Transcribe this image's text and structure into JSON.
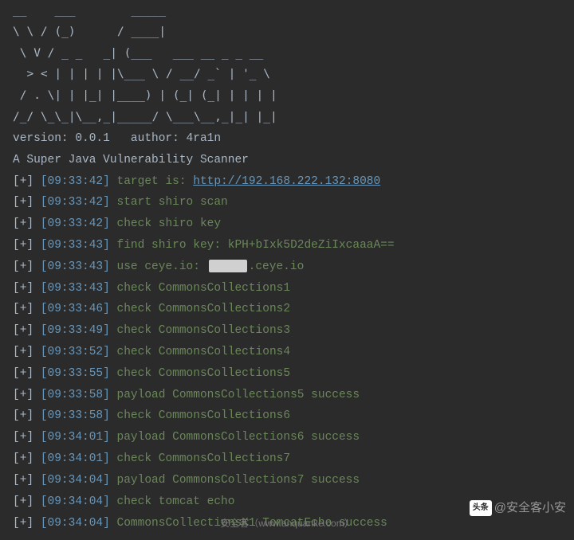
{
  "ascii_banner": [
    "__    ___        _____ ",
    "\\ \\ / (_)      / ____|",
    " \\ V / _ _   _| (___   ___ __ _ _ __ ",
    "  > < | | | | |\\___ \\ / __/ _` | '_ \\",
    " / . \\| | |_| |____) | (_| (_| | | | |",
    "/_/ \\_\\_|\\__,_|_____/ \\___\\__,_|_| |_|"
  ],
  "version_line": "version: 0.0.1   author: 4ra1n",
  "subtitle": "A Super Java Vulnerability Scanner",
  "prefix": "[+]",
  "target_url": "http://192.168.222.132:8080",
  "logs": [
    {
      "ts": "[09:33:42]",
      "type": "target",
      "pre": "target is: "
    },
    {
      "ts": "[09:33:42]",
      "type": "plain",
      "msg": "start shiro scan"
    },
    {
      "ts": "[09:33:42]",
      "type": "plain",
      "msg": "check shiro key"
    },
    {
      "ts": "[09:33:43]",
      "type": "plain",
      "msg": "find shiro key: kPH+bIxk5D2deZiIxcaaaA=="
    },
    {
      "ts": "[09:33:43]",
      "type": "ceye",
      "pre": "use ceye.io: ",
      "suf": ".ceye.io"
    },
    {
      "ts": "[09:33:43]",
      "type": "plain",
      "msg": "check CommonsCollections1"
    },
    {
      "ts": "[09:33:46]",
      "type": "plain",
      "msg": "check CommonsCollections2"
    },
    {
      "ts": "[09:33:49]",
      "type": "plain",
      "msg": "check CommonsCollections3"
    },
    {
      "ts": "[09:33:52]",
      "type": "plain",
      "msg": "check CommonsCollections4"
    },
    {
      "ts": "[09:33:55]",
      "type": "plain",
      "msg": "check CommonsCollections5"
    },
    {
      "ts": "[09:33:58]",
      "type": "plain",
      "msg": "payload CommonsCollections5 success"
    },
    {
      "ts": "[09:33:58]",
      "type": "plain",
      "msg": "check CommonsCollections6"
    },
    {
      "ts": "[09:34:01]",
      "type": "plain",
      "msg": "payload CommonsCollections6 success"
    },
    {
      "ts": "[09:34:01]",
      "type": "plain",
      "msg": "check CommonsCollections7"
    },
    {
      "ts": "[09:34:04]",
      "type": "plain",
      "msg": "payload CommonsCollections7 success"
    },
    {
      "ts": "[09:34:04]",
      "type": "plain",
      "msg": "check tomcat echo"
    },
    {
      "ts": "[09:34:04]",
      "type": "plain",
      "msg": "CommonsCollectionsK1 TomcatEcho success"
    }
  ],
  "watermark_author": "@安全客小安",
  "watermark_brand": "头条",
  "watermark_site": "安全客（www.anquanke.com）"
}
